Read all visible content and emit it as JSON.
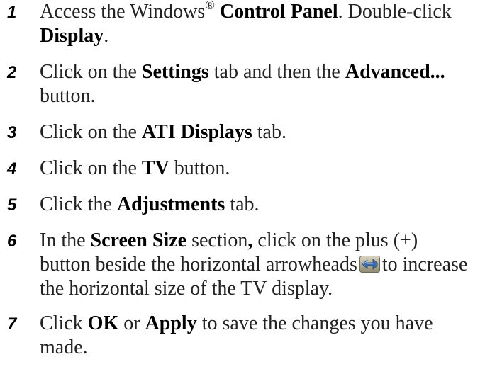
{
  "steps": [
    {
      "num": "1",
      "parts": [
        "Access the Windows",
        "®",
        " ",
        "Control Panel",
        ". Double-click ",
        "Display",
        "."
      ]
    },
    {
      "num": "2",
      "parts": [
        "Click on the ",
        "Settings",
        " tab and then the ",
        "Advanced...",
        " button."
      ]
    },
    {
      "num": "3",
      "parts": [
        "Click on the ",
        "ATI Displays",
        " tab."
      ]
    },
    {
      "num": "4",
      "parts": [
        "Click on the ",
        "TV",
        " button."
      ]
    },
    {
      "num": "5",
      "parts": [
        "Click the ",
        "Adjustments",
        " tab."
      ]
    },
    {
      "num": "6",
      "parts": [
        "In the ",
        "Screen Size",
        " section",
        ",",
        " click on the plus (+) button beside the horizontal arrowheads",
        "to increase the horizontal size of the TV display."
      ],
      "icon": "horizontal-arrowheads-icon"
    },
    {
      "num": "7",
      "parts": [
        "Click ",
        "OK",
        " or ",
        "Apply",
        " to save the changes you have made."
      ]
    }
  ]
}
